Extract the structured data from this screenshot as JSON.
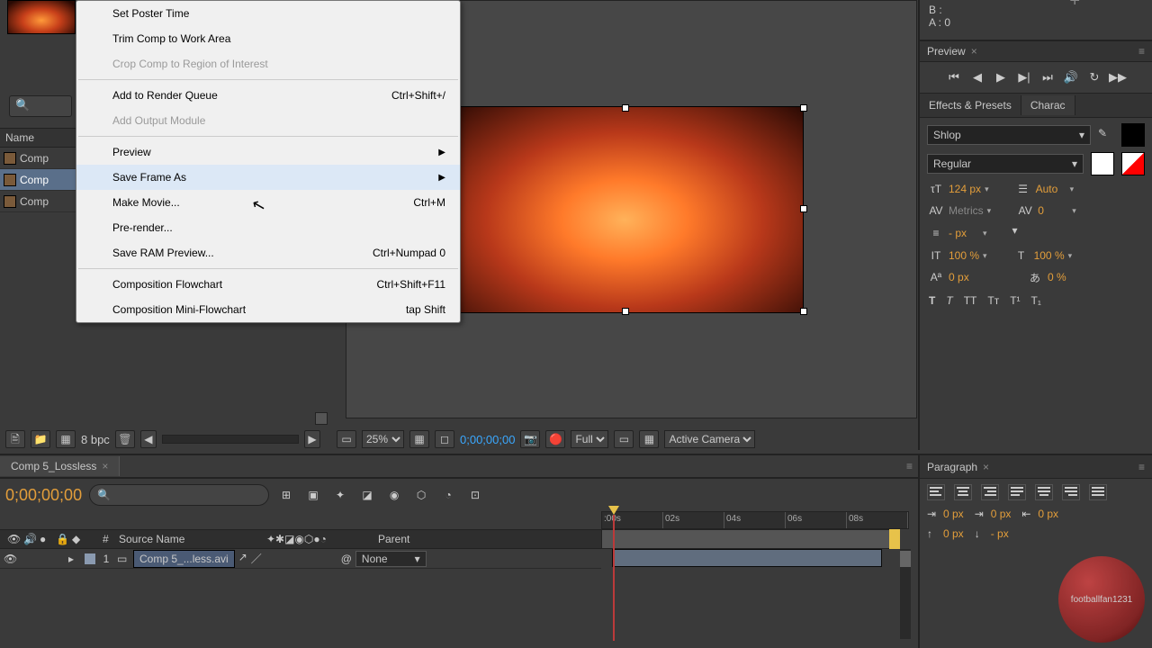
{
  "info": {
    "b": "B :",
    "a": "A : 0",
    "plus": "+"
  },
  "project": {
    "search_placeholder": "",
    "name_header": "Name",
    "rows": [
      "Comp",
      "Comp",
      "Comp"
    ]
  },
  "context_menu": {
    "set_poster": "Set Poster Time",
    "trim": "Trim Comp to Work Area",
    "crop": "Crop Comp to Region of Interest",
    "add_render": "Add to Render Queue",
    "add_render_sc": "Ctrl+Shift+/",
    "add_output": "Add Output Module",
    "preview": "Preview",
    "save_frame": "Save Frame As",
    "make_movie": "Make Movie...",
    "make_movie_sc": "Ctrl+M",
    "pre_render": "Pre-render...",
    "save_ram": "Save RAM Preview...",
    "save_ram_sc": "Ctrl+Numpad 0",
    "flowchart": "Composition Flowchart",
    "flowchart_sc": "Ctrl+Shift+F11",
    "mini_flowchart": "Composition Mini-Flowchart",
    "mini_flowchart_sc": "tap Shift"
  },
  "proj_footer": {
    "bpc": "8 bpc"
  },
  "viewer": {
    "zoom": "25%",
    "timecode": "0;00;00;00",
    "quality": "Full",
    "camera": "Active Camera"
  },
  "preview": {
    "title": "Preview"
  },
  "effects_presets": {
    "tab": "Effects & Presets"
  },
  "character": {
    "tab": "Charac",
    "font": "Shlop",
    "weight": "Regular",
    "size_val": "124",
    "size_unit": "px",
    "leading": "Auto",
    "kerning": "Metrics",
    "tracking": "0",
    "stroke": "-",
    "stroke_unit": "px",
    "vscale": "100",
    "hscale": "100",
    "baseline": "0",
    "baseline_unit": "px",
    "tsume": "0",
    "tsume_unit": "%",
    "pct": "%",
    "styles": {
      "bold": "T",
      "italic": "T",
      "caps": "TT",
      "small": "Tᴛ",
      "super": "T¹",
      "sub": "T₁"
    }
  },
  "timeline": {
    "tab": "Comp 5_Lossless",
    "timecode": "0;00;00;00",
    "ruler": [
      ":00s",
      "02s",
      "04s",
      "06s",
      "08s"
    ],
    "layer_header": {
      "num": "#",
      "source": "Source Name",
      "parent": "Parent"
    },
    "layer1": {
      "num": "1",
      "name": "Comp 5_...less.avi",
      "parent": "None"
    }
  },
  "paragraph": {
    "title": "Paragraph",
    "px1": "0 px",
    "px2": "0 px",
    "px3": "0 px",
    "px4": "0 px",
    "px5": "- px"
  },
  "watermark": "footballfan1231"
}
